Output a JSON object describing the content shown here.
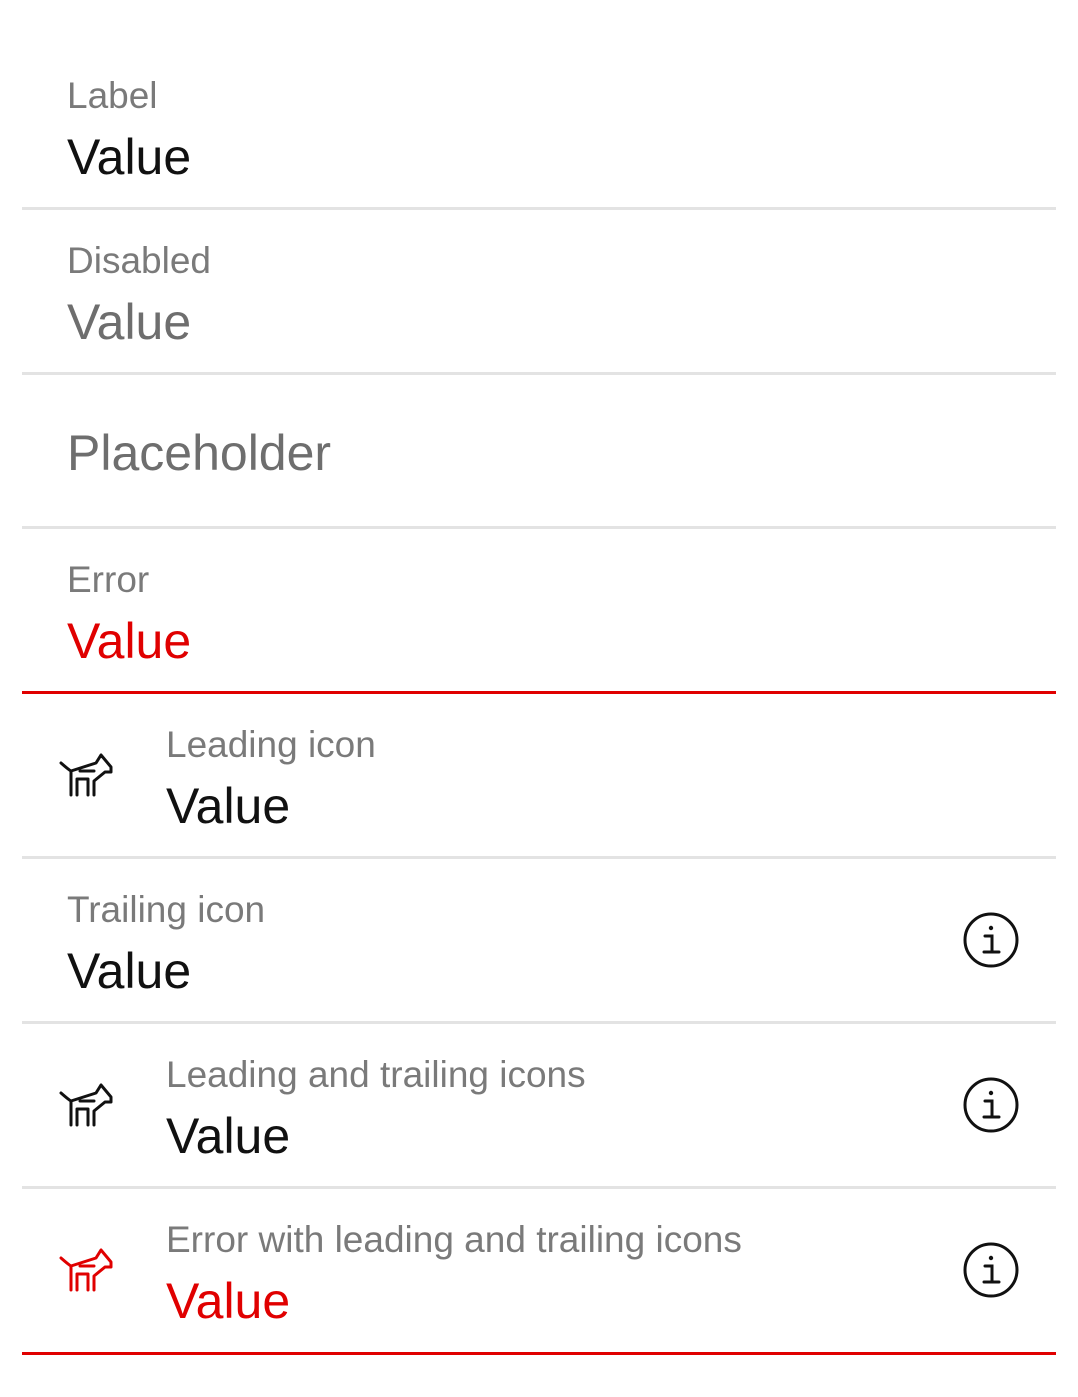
{
  "fields": [
    {
      "label": "Label",
      "value": "Value",
      "state": "normal"
    },
    {
      "label": "Disabled",
      "value": "Value",
      "state": "disabled"
    },
    {
      "placeholder": "Placeholder",
      "state": "empty"
    },
    {
      "label": "Error",
      "value": "Value",
      "state": "error"
    },
    {
      "label": "Leading icon",
      "value": "Value",
      "state": "normal",
      "leading_icon": "dog-icon"
    },
    {
      "label": "Trailing icon",
      "value": "Value",
      "state": "normal",
      "trailing_icon": "info-icon"
    },
    {
      "label": "Leading and trailing icons",
      "value": "Value",
      "state": "normal",
      "leading_icon": "dog-icon",
      "trailing_icon": "info-icon"
    },
    {
      "label": "Error with leading and trailing icons",
      "value": "Value",
      "state": "error",
      "leading_icon": "dog-icon",
      "trailing_icon": "info-icon"
    }
  ],
  "colors": {
    "error": "#e00000",
    "divider": "#e3e3e3",
    "label": "#7a7a7a",
    "value": "#111111",
    "muted": "#6e6e6e"
  }
}
